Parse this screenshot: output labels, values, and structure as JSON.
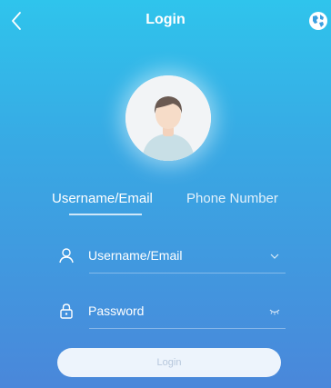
{
  "header": {
    "title": "Login",
    "back_icon": "chevron-left-icon",
    "globe_icon": "globe-icon"
  },
  "avatar_icon": "user-avatar-icon",
  "tabs": [
    {
      "label": "Username/Email",
      "active": true
    },
    {
      "label": "Phone Number",
      "active": false
    }
  ],
  "form": {
    "username": {
      "text": "Username/Email",
      "icon": "user-icon",
      "end_icon": "chevron-down-icon"
    },
    "password": {
      "text": "Password",
      "icon": "lock-icon",
      "end_icon": "eye-closed-icon"
    }
  },
  "login_button": {
    "label": "Login"
  },
  "colors": {
    "gradient_top": "#2fc4ec",
    "gradient_bottom": "#4a87da",
    "button_text": "#b6c7dc"
  }
}
